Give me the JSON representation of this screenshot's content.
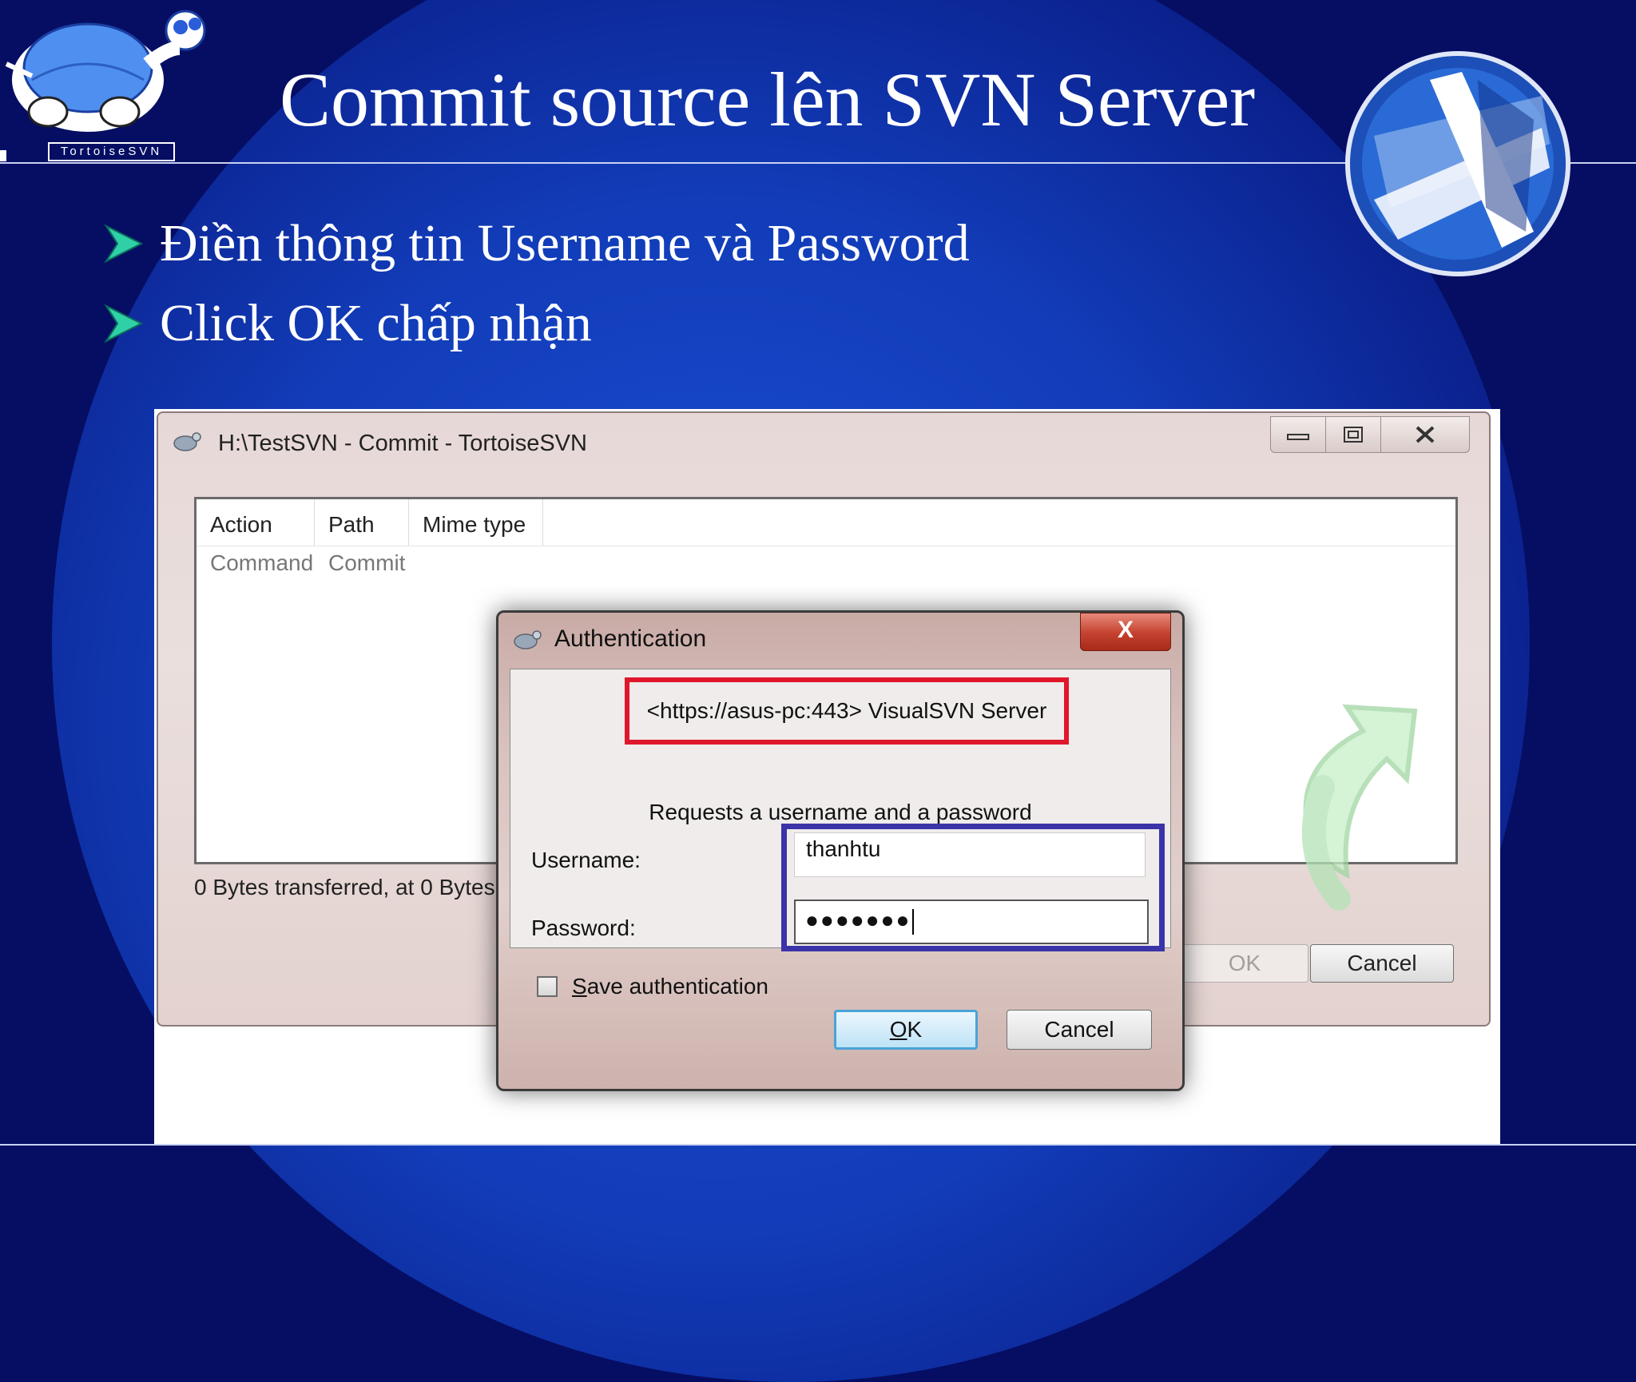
{
  "slide": {
    "title": "Commit source lên SVN Server",
    "logo_caption": "TortoiseSVN",
    "bullets": [
      "Điền thông tin Username và Password",
      "Click OK chấp nhận"
    ]
  },
  "commit_window": {
    "title": "H:\\TestSVN - Commit - TortoiseSVN",
    "columns": [
      "Action",
      "Path",
      "Mime type"
    ],
    "rows": [
      {
        "action": "Command",
        "path": "Commit",
        "mime": ""
      }
    ],
    "status": "0 Bytes transferred, at 0 Bytes",
    "ok_label": "OK",
    "cancel_label": "Cancel"
  },
  "auth_dialog": {
    "title": "Authentication",
    "close_label": "X",
    "realm": "<https://asus-pc:443> VisualSVN Server",
    "request": "Requests a username and a password",
    "username_label": "Username:",
    "username_value": "thanhtu",
    "password_label": "Password:",
    "password_masked": "●●●●●●●",
    "save_auth_label": "Save authentication",
    "save_auth_checked": false,
    "ok_label": "OK",
    "cancel_label": "Cancel"
  },
  "colors": {
    "slide_background": "#050e63",
    "realm_highlight": "#e0172b",
    "credentials_highlight": "#3a34a8"
  }
}
